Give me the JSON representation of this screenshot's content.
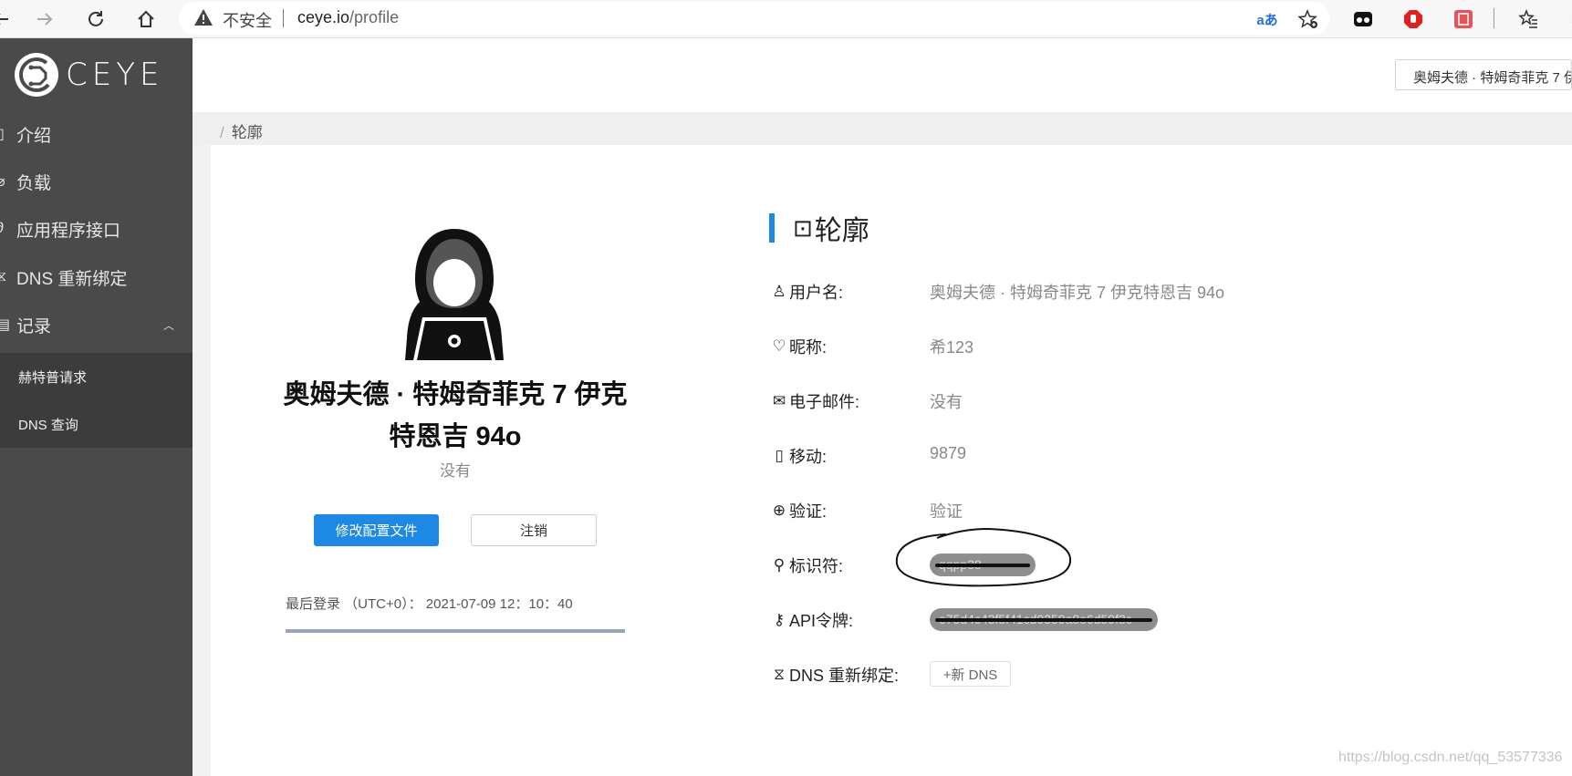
{
  "browser": {
    "insecure_label": "不安全",
    "url_host": "ceye.io",
    "url_path": "/profile"
  },
  "sidebar": {
    "logo_text": "CEYE",
    "items": [
      {
        "label": "介绍",
        "icon": "book-icon"
      },
      {
        "label": "负载",
        "icon": "tag-icon"
      },
      {
        "label": "应用程序接口",
        "icon": "link-icon"
      },
      {
        "label": "DNS 重新绑定",
        "icon": "hourglass-icon"
      },
      {
        "label": "记录",
        "icon": "list-icon"
      }
    ],
    "submenu": [
      {
        "label": "赫特普请求"
      },
      {
        "label": "DNS 查询"
      }
    ]
  },
  "header": {
    "user_chip": "奥姆夫德 · 特姆奇菲克 7 伊"
  },
  "breadcrumb": {
    "current": "轮廓"
  },
  "profile_card": {
    "name": "奥姆夫德 · 特姆奇菲克 7 伊克特恩吉 94o",
    "subtitle": "没有",
    "edit_button": "修改配置文件",
    "logout_button": "注销",
    "last_login": "最后登录 （UTC+0）： 2021-07-09 12：10：40"
  },
  "profile_info": {
    "title": "轮廓",
    "rows": [
      {
        "label": "用户名:",
        "value": "奥姆夫德 · 特姆奇菲克 7 伊克特恩吉 94o",
        "icon": "user-icon"
      },
      {
        "label": "昵称:",
        "value": "希123",
        "icon": "heart-icon"
      },
      {
        "label": "电子邮件:",
        "value": "没有",
        "icon": "mail-icon"
      },
      {
        "label": "移动:",
        "value": "9879",
        "icon": "phone-icon"
      },
      {
        "label": "验证:",
        "value": "验证",
        "icon": "lock-icon"
      },
      {
        "label": "标识符:",
        "value": "qqpp38",
        "icon": "rocket-icon"
      },
      {
        "label": "API令牌:",
        "value": "e75d4c43f5f41cd0359a8e6d59f3c",
        "icon": "key-icon"
      },
      {
        "label": "DNS 重新绑定:",
        "value": "+新 DNS",
        "icon": "hourglass-icon"
      }
    ]
  },
  "watermark": "https://blog.csdn.net/qq_53577336",
  "colors": {
    "accent": "#1e88e5",
    "sidebar_bg": "#4a4a4a",
    "submenu_bg": "#3c3c3c"
  }
}
